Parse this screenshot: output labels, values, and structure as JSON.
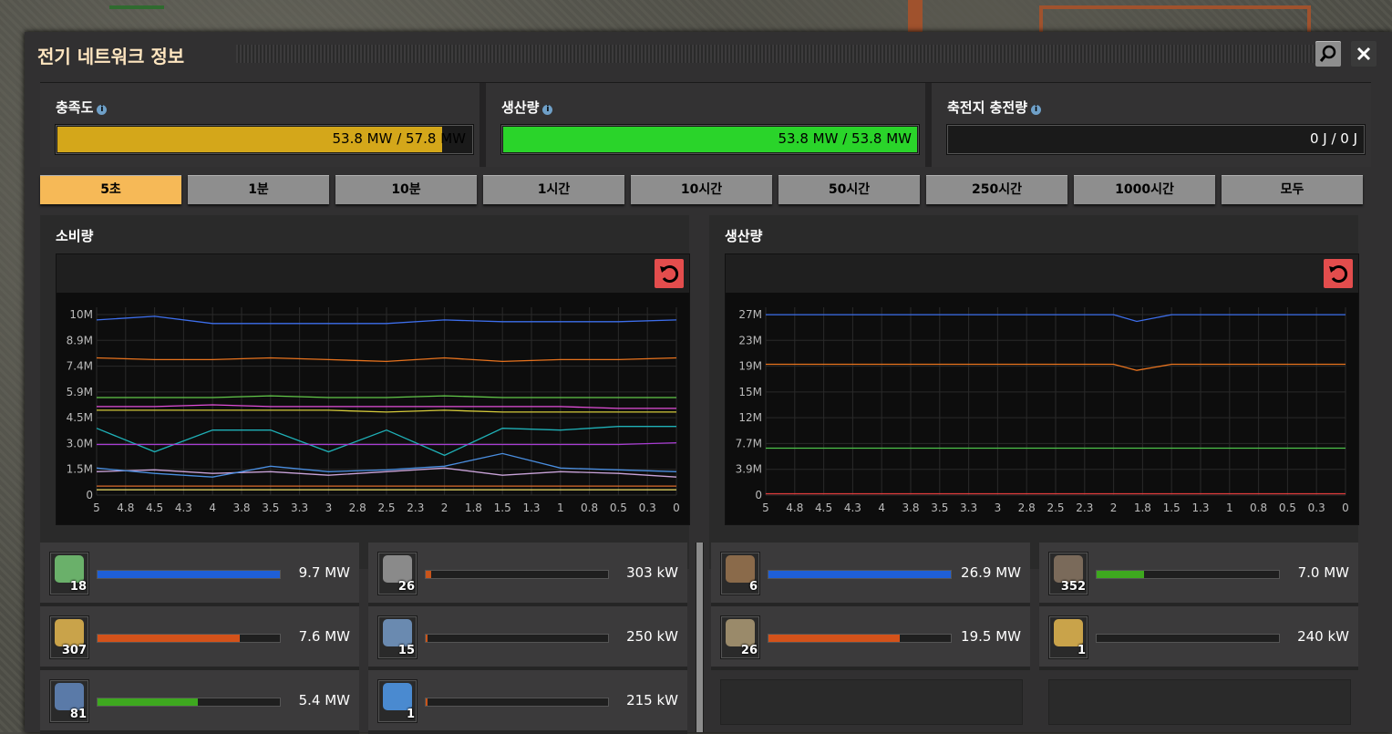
{
  "window": {
    "title": "전기 네트워크 정보"
  },
  "stats": [
    {
      "label": "충족도",
      "value": "53.8 MW / 57.8 MW",
      "fill_fraction": 0.93,
      "color": "#d4a71a"
    },
    {
      "label": "생산량",
      "value": "53.8 MW / 53.8 MW",
      "fill_fraction": 1.0,
      "color": "#2ad42a"
    },
    {
      "label": "축전지 충전량",
      "value": "0 J / 0 J",
      "fill_fraction": 0,
      "color": "#2ad42a"
    }
  ],
  "tabs": [
    "5초",
    "1분",
    "10분",
    "1시간",
    "10시간",
    "50시간",
    "250시간",
    "1000시간",
    "모두"
  ],
  "active_tab": "5초",
  "consumption_title": "소비량",
  "production_title": "생산량",
  "chart_data": [
    {
      "type": "line",
      "title": "소비량",
      "x_ticks": [
        "5",
        "4.8",
        "4.5",
        "4.3",
        "4",
        "3.8",
        "3.5",
        "3.3",
        "3",
        "2.8",
        "2.5",
        "2.3",
        "2",
        "1.8",
        "1.5",
        "1.3",
        "1",
        "0.8",
        "0.5",
        "0.3",
        "0"
      ],
      "y_ticks": [
        "10M",
        "8.9M",
        "7.4M",
        "5.9M",
        "4.5M",
        "3.0M",
        "1.5M",
        "0"
      ],
      "ylim": [
        0,
        10400000
      ],
      "x": [
        5,
        4.5,
        4,
        3.5,
        3,
        2.5,
        2,
        1.5,
        1,
        0.5,
        0
      ],
      "series": [
        {
          "color": "#3d6eeb",
          "values": [
            9.7,
            9.9,
            9.5,
            9.5,
            9.5,
            9.5,
            9.7,
            9.6,
            9.6,
            9.6,
            9.7
          ]
        },
        {
          "color": "#e8731e",
          "values": [
            7.6,
            7.5,
            7.5,
            7.6,
            7.5,
            7.4,
            7.6,
            7.4,
            7.5,
            7.5,
            7.6
          ]
        },
        {
          "color": "#63c94a",
          "values": [
            5.4,
            5.4,
            5.4,
            5.5,
            5.4,
            5.4,
            5.5,
            5.4,
            5.4,
            5.4,
            5.4
          ]
        },
        {
          "color": "#e24fd9",
          "values": [
            4.9,
            4.9,
            5.0,
            4.9,
            4.9,
            4.9,
            4.9,
            4.9,
            4.9,
            4.8,
            4.8
          ]
        },
        {
          "color": "#d4c93a",
          "values": [
            4.7,
            4.7,
            4.7,
            4.7,
            4.7,
            4.6,
            4.7,
            4.6,
            4.6,
            4.6,
            4.6
          ]
        },
        {
          "color": "#1fb0b7",
          "values": [
            3.7,
            2.4,
            3.6,
            3.6,
            2.4,
            3.6,
            2.2,
            3.7,
            3.6,
            3.8,
            3.8
          ]
        },
        {
          "color": "#a93cd4",
          "values": [
            2.8,
            2.8,
            2.8,
            2.8,
            2.8,
            2.8,
            2.8,
            2.8,
            2.8,
            2.8,
            2.9
          ]
        },
        {
          "color": "#c9a3d9",
          "values": [
            1.3,
            1.4,
            1.2,
            1.3,
            1.1,
            1.3,
            1.5,
            1.1,
            1.3,
            1.2,
            1.0
          ]
        },
        {
          "color": "#4a8ee0",
          "values": [
            1.5,
            1.2,
            1.0,
            1.6,
            1.3,
            1.4,
            1.6,
            2.3,
            1.5,
            1.4,
            1.3
          ]
        },
        {
          "color": "#d96b2c",
          "values": [
            0.5,
            0.5,
            0.5,
            0.5,
            0.5,
            0.5,
            0.5,
            0.5,
            0.5,
            0.5,
            0.5
          ]
        },
        {
          "color": "#f0e06a",
          "values": [
            0.3,
            0.3,
            0.3,
            0.3,
            0.3,
            0.3,
            0.3,
            0.3,
            0.3,
            0.3,
            0.3
          ]
        }
      ]
    },
    {
      "type": "line",
      "title": "생산량",
      "x_ticks": [
        "5",
        "4.8",
        "4.5",
        "4.3",
        "4",
        "3.8",
        "3.5",
        "3.3",
        "3",
        "2.8",
        "2.5",
        "2.3",
        "2",
        "1.8",
        "1.5",
        "1.3",
        "1",
        "0.8",
        "0.5",
        "0.3",
        "0"
      ],
      "y_ticks": [
        "27M",
        "23M",
        "19M",
        "15M",
        "12M",
        "7.7M",
        "3.9M",
        "0"
      ],
      "ylim": [
        0,
        28000000
      ],
      "x": [
        5,
        4.5,
        4,
        3.5,
        3,
        2.5,
        2,
        1.8,
        1.5,
        1,
        0.5,
        0
      ],
      "series": [
        {
          "color": "#3d6eeb",
          "values": [
            26.9,
            26.9,
            26.9,
            26.9,
            26.9,
            26.9,
            26.9,
            25.9,
            26.9,
            26.9,
            26.9,
            26.9
          ]
        },
        {
          "color": "#e8731e",
          "values": [
            19.5,
            19.5,
            19.5,
            19.5,
            19.5,
            19.5,
            19.5,
            18.6,
            19.5,
            19.5,
            19.5,
            19.5
          ]
        },
        {
          "color": "#4ec24a",
          "values": [
            7.0,
            7.0,
            7.0,
            7.0,
            7.0,
            7.0,
            7.0,
            7.0,
            7.0,
            7.0,
            7.0,
            7.0
          ]
        },
        {
          "color": "#e03c3c",
          "values": [
            0.2,
            0.2,
            0.2,
            0.2,
            0.2,
            0.2,
            0.2,
            0.2,
            0.2,
            0.2,
            0.2,
            0.2
          ]
        }
      ]
    }
  ],
  "consumers": [
    {
      "icon": "assembling-machine-icon",
      "count": "18",
      "value": "9.7 MW",
      "fraction": 1.0,
      "color": "#1f5fd6",
      "glyph_color": "#6ab06a"
    },
    {
      "icon": "lab-icon",
      "count": "26",
      "value": "303 kW",
      "fraction": 0.03,
      "color": "#c9541a",
      "glyph_color": "#8a8a8a"
    },
    {
      "icon": "electric-mining-drill-icon",
      "count": "307",
      "value": "7.6 MW",
      "fraction": 0.78,
      "color": "#d4521a",
      "glyph_color": "#c9a34a"
    },
    {
      "icon": "radar-icon",
      "count": "15",
      "value": "250 kW",
      "fraction": 0.01,
      "color": "#c9541a",
      "glyph_color": "#6a8ab0"
    },
    {
      "icon": "inserter-icon",
      "count": "81",
      "value": "5.4 MW",
      "fraction": 0.55,
      "color": "#3ea81f",
      "glyph_color": "#5a7aa8"
    },
    {
      "icon": "roboport-icon",
      "count": "1",
      "value": "215 kW",
      "fraction": 0.01,
      "color": "#c9541a",
      "glyph_color": "#4a8ad0"
    }
  ],
  "producers": [
    {
      "icon": "steam-engine-icon",
      "count": "6",
      "value": "26.9 MW",
      "fraction": 1.0,
      "color": "#1f5fd6",
      "glyph_color": "#8a6a4a"
    },
    {
      "icon": "solar-panel-icon",
      "count": "352",
      "value": "7.0 MW",
      "fraction": 0.26,
      "color": "#3ea81f",
      "glyph_color": "#7a6a5a"
    },
    {
      "icon": "steam-turbine-icon",
      "count": "26",
      "value": "19.5 MW",
      "fraction": 0.72,
      "color": "#d4521a",
      "glyph_color": "#9a8a6a"
    },
    {
      "icon": "generator-icon",
      "count": "1",
      "value": "240 kW",
      "fraction": 0.0,
      "color": "#d4521a",
      "glyph_color": "#c9a34a"
    }
  ]
}
